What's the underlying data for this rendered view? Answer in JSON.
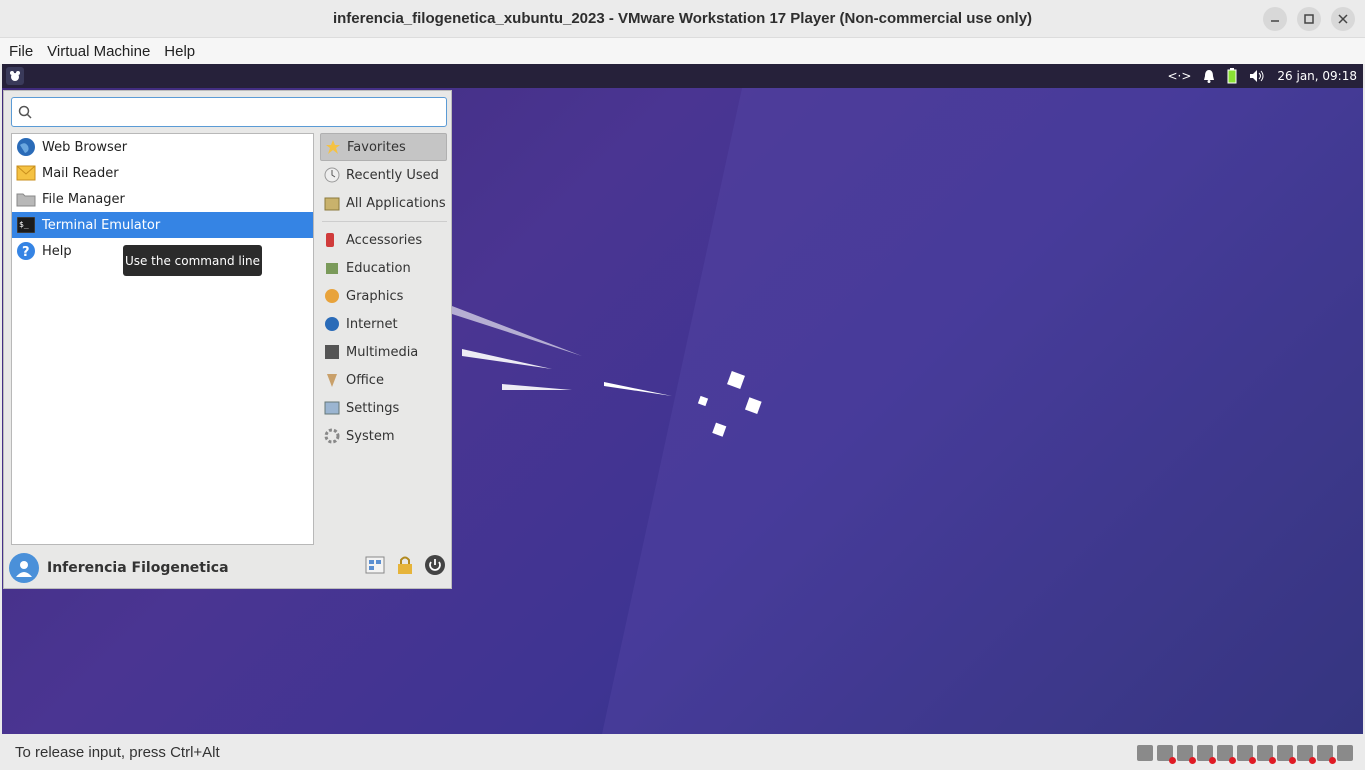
{
  "window": {
    "title": "inferencia_filogenetica_xubuntu_2023 - VMware Workstation 17 Player (Non-commercial use only)"
  },
  "menubar": {
    "items": [
      "File",
      "Virtual Machine",
      "Help"
    ]
  },
  "guest_panel": {
    "clock": "26 jan, 09:18"
  },
  "whisker_menu": {
    "search": {
      "value": "",
      "placeholder": ""
    },
    "apps": [
      {
        "label": "Web Browser",
        "icon": "web-browser-icon"
      },
      {
        "label": "Mail Reader",
        "icon": "mail-icon"
      },
      {
        "label": "File Manager",
        "icon": "folder-icon"
      },
      {
        "label": "Terminal Emulator",
        "icon": "terminal-icon",
        "selected": true
      },
      {
        "label": "Help",
        "icon": "help-icon"
      }
    ],
    "categories_top": [
      "Favorites",
      "Recently Used",
      "All Applications"
    ],
    "categories": [
      "Accessories",
      "Education",
      "Graphics",
      "Internet",
      "Multimedia",
      "Office",
      "Settings",
      "System"
    ],
    "username": "Inferencia Filogenetica",
    "tooltip": "Use the command line"
  },
  "statusbar": {
    "text": "To release input, press Ctrl+Alt"
  },
  "colors": {
    "selection": "#3584e4",
    "panel": "#26213a"
  }
}
